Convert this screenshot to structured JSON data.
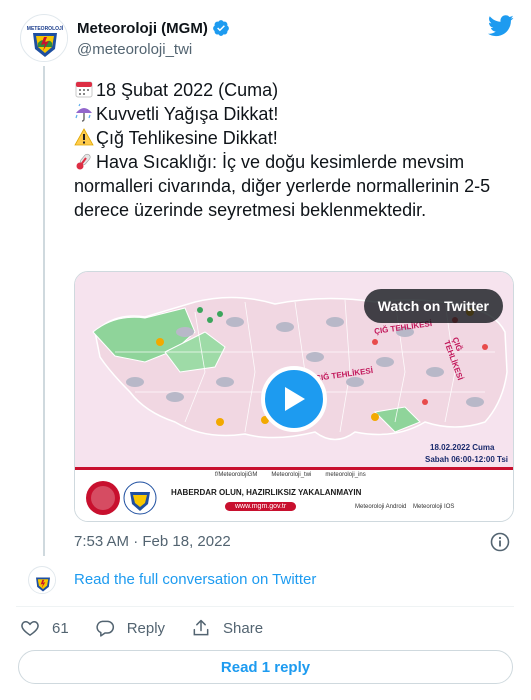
{
  "account": {
    "display_name": "Meteoroloji (MGM)",
    "handle": "@meteoroloji_twi",
    "logo_text": "METEOROLOJİ"
  },
  "tweet": {
    "line1": "18 Şubat 2022 (Cuma)",
    "line2": "Kuvvetli Yağışa Dikkat!",
    "line3": "Çığ Tehlikesine Dikkat!",
    "line4": "Hava Sıcaklığı:  İç ve doğu kesimlerde mevsim normalleri civarında, diğer yerlerde normallerinin 2-5 derece üzerinde seyretmesi beklenmektedir."
  },
  "media": {
    "watch_label": "Watch on Twitter",
    "map_date": "18.02.2022 Cuma",
    "map_time": "Sabah 06:00-12:00 Tsi",
    "avalanche_label": "ÇIĞ TEHLİKESİ",
    "social_fb": "f/MeteorolojiGM",
    "social_tw": "Meteoroloji_twi",
    "social_ig": "meteoroloji_ins",
    "slogan": "HABERDAR OLUN, HAZIRLIKSIZ YAKALANMAYIN",
    "url": "www.mgm.gov.tr",
    "app_android": "Meteoroloji Android",
    "app_ios": "Meteoroloji IOS"
  },
  "meta": {
    "timestamp": "7:53 AM · Feb 18, 2022",
    "read_conversation": "Read the full conversation on Twitter"
  },
  "actions": {
    "likes": "61",
    "reply_label": "Reply",
    "share_label": "Share",
    "read_reply": "Read 1 reply"
  },
  "colors": {
    "brand": "#1d9bf0",
    "text_primary": "#0f1419",
    "text_secondary": "#536471"
  },
  "icons": [
    "verified-badge-icon",
    "twitter-bird-icon",
    "calendar-icon",
    "umbrella-rain-icon",
    "warning-icon",
    "thermometer-icon",
    "play-icon",
    "info-icon",
    "heart-icon",
    "reply-icon",
    "share-icon"
  ]
}
